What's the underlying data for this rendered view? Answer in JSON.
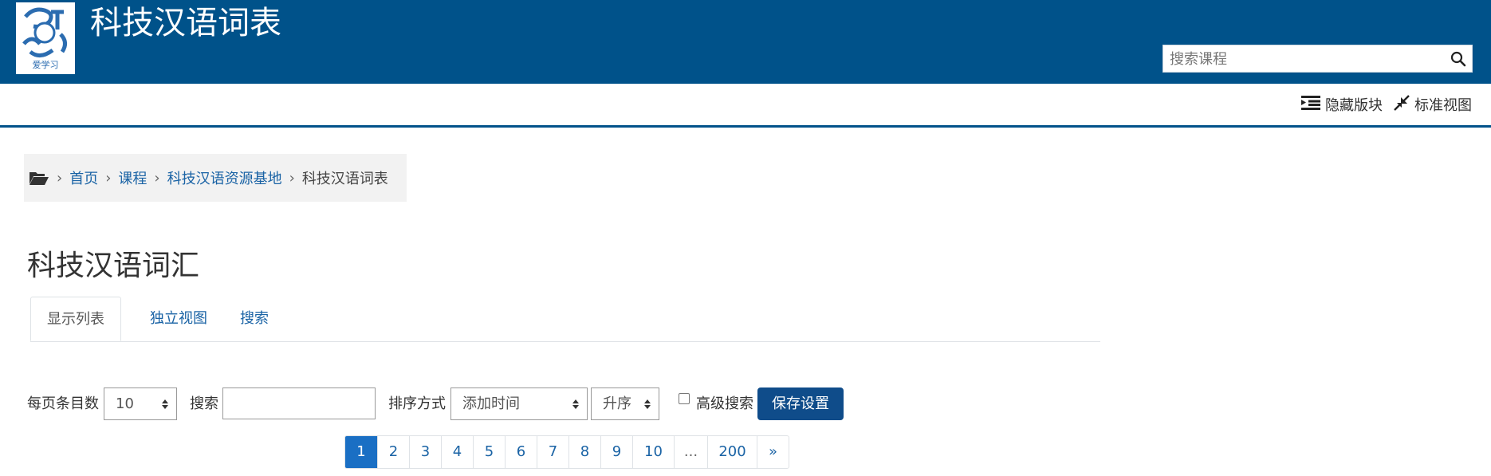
{
  "header": {
    "site_title": "科技汉语词表",
    "logo_text": "爱学习",
    "search_placeholder": "搜索课程"
  },
  "topbar": {
    "hide_blocks": "隐藏版块",
    "standard_view": "标准视图"
  },
  "breadcrumb": {
    "items": [
      "首页",
      "课程",
      "科技汉语资源基地"
    ],
    "current": "科技汉语词表"
  },
  "page": {
    "title": "科技汉语词汇"
  },
  "tabs": [
    {
      "label": "显示列表",
      "active": true
    },
    {
      "label": "独立视图",
      "active": false
    },
    {
      "label": "搜索",
      "active": false
    }
  ],
  "controls": {
    "per_page_label": "每页条目数",
    "per_page_value": "10",
    "search_label": "搜索",
    "search_value": "",
    "sort_label": "排序方式",
    "sort_value": "添加时间",
    "order_value": "升序",
    "advanced_search_label": "高级搜索",
    "advanced_search_checked": false,
    "save_label": "保存设置"
  },
  "pagination": {
    "pages": [
      "1",
      "2",
      "3",
      "4",
      "5",
      "6",
      "7",
      "8",
      "9",
      "10",
      "...",
      "200",
      "»"
    ],
    "active": "1"
  },
  "colors": {
    "brand": "#00528a",
    "link": "#1a63a5",
    "button": "#0f4c8a",
    "active_page": "#1a6fc4"
  }
}
